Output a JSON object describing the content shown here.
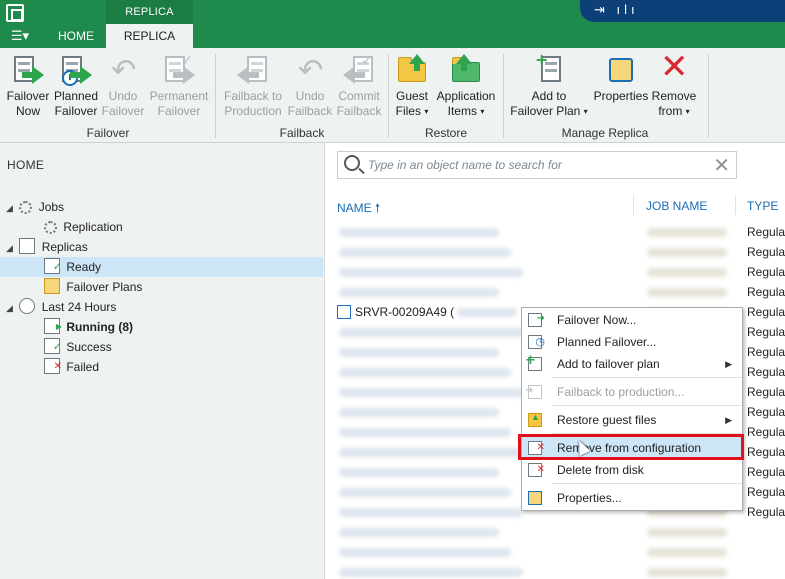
{
  "app": {
    "contextual_group": "REPLICA TOOLS",
    "menu_glyph": "☰▾",
    "status_icons": "⇥ ılı"
  },
  "tabs": [
    {
      "label": "HOME",
      "active": false
    },
    {
      "label": "REPLICA",
      "active": true
    }
  ],
  "ribbon": {
    "groups": {
      "failover": "Failover",
      "failback": "Failback",
      "restore": "Restore",
      "manage": "Manage Replica"
    },
    "buttons": {
      "failover_now": [
        "Failover",
        "Now"
      ],
      "planned_failover": [
        "Planned",
        "Failover"
      ],
      "undo_failover": [
        "Undo",
        "Failover"
      ],
      "permanent_failover": [
        "Permanent",
        "Failover"
      ],
      "failback_production": [
        "Failback to",
        "Production"
      ],
      "undo_failback": [
        "Undo",
        "Failback"
      ],
      "commit_failback": [
        "Commit",
        "Failback"
      ],
      "guest_files": [
        "Guest",
        "Files"
      ],
      "application_items": [
        "Application",
        "Items"
      ],
      "add_to_failover_plan": [
        "Add to",
        "Failover Plan"
      ],
      "properties": [
        "Properties",
        ""
      ],
      "remove_from": [
        "Remove",
        "from"
      ]
    }
  },
  "nav": {
    "header": "HOME",
    "tree": [
      {
        "label": "Jobs",
        "level": 0,
        "icon": "jobs-icon"
      },
      {
        "label": "Replication",
        "level": 1,
        "icon": "replication-job-icon"
      },
      {
        "label": "Replicas",
        "level": 0,
        "icon": "replicas-icon"
      },
      {
        "label": "Ready",
        "level": 1,
        "icon": "replica-ready-icon",
        "selected": true
      },
      {
        "label": "Failover Plans",
        "level": 1,
        "icon": "failover-plan-icon"
      },
      {
        "label": "Last 24 Hours",
        "level": 0,
        "icon": "history-icon"
      },
      {
        "label": "Running (8)",
        "level": 1,
        "icon": "running-icon",
        "bold": true
      },
      {
        "label": "Success",
        "level": 1,
        "icon": "success-icon"
      },
      {
        "label": "Failed",
        "level": 1,
        "icon": "failed-icon"
      }
    ]
  },
  "search": {
    "placeholder": "Type in an object name to search for",
    "value": ""
  },
  "table": {
    "columns": [
      "NAME",
      "JOB NAME",
      "TYPE"
    ],
    "sort_glyph": "🠕",
    "selected_row_name": "SRVR-00209A49 (",
    "row_type": "Regular"
  },
  "context_menu": {
    "items": [
      {
        "label": "Failover Now...",
        "icon": "failover-now-icon",
        "enabled": true,
        "submenu": false
      },
      {
        "label": "Planned Failover...",
        "icon": "planned-failover-icon",
        "enabled": true,
        "submenu": false
      },
      {
        "label": "Add to failover plan",
        "icon": "add-to-plan-icon",
        "enabled": true,
        "submenu": true
      },
      {
        "label": "Failback to production...",
        "icon": "failback-icon",
        "enabled": false,
        "submenu": false
      },
      {
        "label": "Restore guest files",
        "icon": "restore-guest-files-icon",
        "enabled": true,
        "submenu": true
      },
      {
        "label": "Remove from configuration",
        "icon": "remove-config-icon",
        "enabled": true,
        "submenu": false,
        "highlighted": true
      },
      {
        "label": "Delete from disk",
        "icon": "delete-disk-icon",
        "enabled": true,
        "submenu": false
      },
      {
        "label": "Properties...",
        "icon": "properties-icon",
        "enabled": true,
        "submenu": false
      }
    ],
    "submenu_glyph": "▶"
  },
  "colors": {
    "brand_green": "#1e8a4c",
    "highlight_box": "#e3101b",
    "selection": "#cde6f7",
    "link_blue": "#1b6db5"
  }
}
